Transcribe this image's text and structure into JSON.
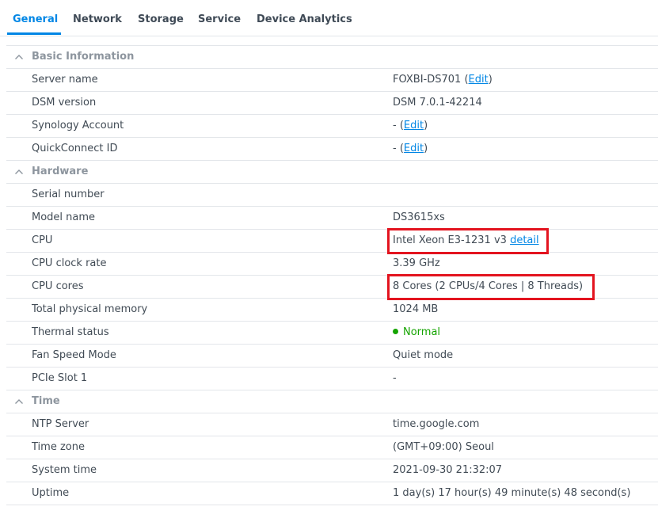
{
  "tabs": [
    {
      "label": "General"
    },
    {
      "label": "Network"
    },
    {
      "label": "Storage"
    },
    {
      "label": "Service"
    },
    {
      "label": "Device Analytics"
    }
  ],
  "sections": {
    "basic": {
      "title": "Basic Information",
      "server_name": {
        "label": "Server name",
        "value": "FOXBI-DS701",
        "edit": "Edit"
      },
      "dsm_version": {
        "label": "DSM version",
        "value": "DSM 7.0.1-42214"
      },
      "synology_account": {
        "label": "Synology Account",
        "value": "-",
        "edit": "Edit"
      },
      "quickconnect_id": {
        "label": "QuickConnect ID",
        "value": "-",
        "edit": "Edit"
      }
    },
    "hardware": {
      "title": "Hardware",
      "serial_number": {
        "label": "Serial number",
        "value": ""
      },
      "model_name": {
        "label": "Model name",
        "value": "DS3615xs"
      },
      "cpu": {
        "label": "CPU",
        "value": "Intel Xeon E3-1231 v3",
        "detail": "detail"
      },
      "cpu_clock_rate": {
        "label": "CPU clock rate",
        "value": "3.39 GHz"
      },
      "cpu_cores": {
        "label": "CPU cores",
        "value": "8 Cores (2 CPUs/4 Cores | 8 Threads)"
      },
      "total_memory": {
        "label": "Total physical memory",
        "value": "1024 MB"
      },
      "thermal_status": {
        "label": "Thermal status",
        "value": "Normal"
      },
      "fan_speed_mode": {
        "label": "Fan Speed Mode",
        "value": "Quiet mode"
      },
      "pcie_slot_1": {
        "label": "PCIe Slot 1",
        "value": "-"
      }
    },
    "time": {
      "title": "Time",
      "ntp_server": {
        "label": "NTP Server",
        "value": "time.google.com"
      },
      "time_zone": {
        "label": "Time zone",
        "value": "(GMT+09:00) Seoul"
      },
      "system_time": {
        "label": "System time",
        "value": "2021-09-30 21:32:07"
      },
      "uptime": {
        "label": "Uptime",
        "value": "1 day(s) 17 hour(s) 49 minute(s) 48 second(s)"
      }
    }
  },
  "colors": {
    "accent": "#0086e5",
    "status_normal": "#15a400",
    "highlight": "#e3141f"
  },
  "icons": {
    "section_toggle": "chevron-up-icon",
    "status": "status-dot-icon"
  }
}
